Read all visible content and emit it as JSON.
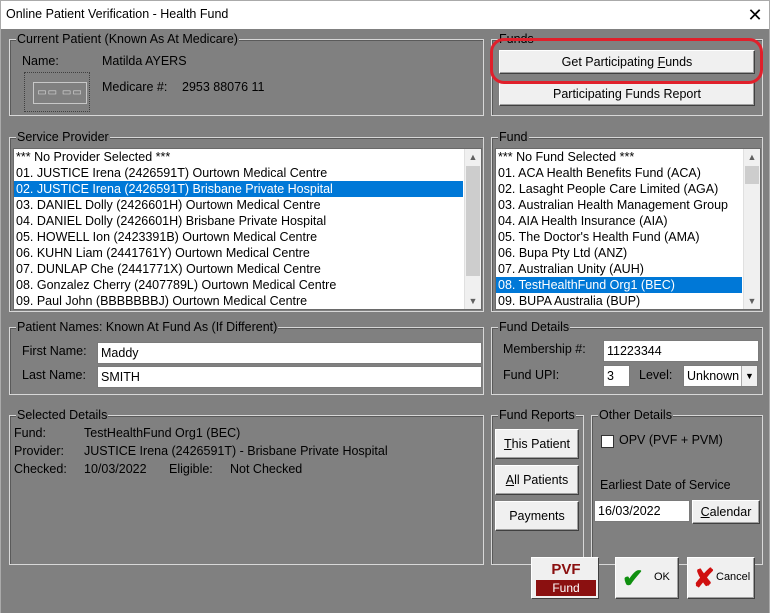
{
  "window": {
    "title": "Online Patient Verification - Health Fund",
    "close_glyph": "✕"
  },
  "current_patient": {
    "legend": "Current Patient  (Known As At Medicare)",
    "name_label": "Name:",
    "name_value": "Matilda AYERS",
    "medicare_label": "Medicare #:",
    "medicare_value": "2953 88076 11",
    "card_glyph": "▭▭ ▭▭"
  },
  "funds_group": {
    "legend": "Funds",
    "get_participating_funds": {
      "pre": "Get Participating ",
      "u": "F",
      "post": "unds"
    },
    "participating_funds_report": "Participating Funds Report",
    "highlight_color": "#e0202b"
  },
  "service_provider": {
    "legend": "Service Provider",
    "items": [
      "*** No Provider Selected ***",
      "01. JUSTICE Irena (2426591T) Ourtown Medical Centre",
      "02. JUSTICE Irena (2426591T) Brisbane Private Hospital",
      "03. DANIEL Dolly (2426601H) Ourtown Medical Centre",
      "04. DANIEL Dolly (2426601H) Brisbane Private Hospital",
      "05. HOWELL Ion (2423391B) Ourtown Medical Centre",
      "06. KUHN Liam (2441761Y) Ourtown Medical Centre",
      "07. DUNLAP Che (2441771X) Ourtown Medical Centre",
      "08. Gonzalez Cherry (2407789L) Ourtown Medical Centre",
      "09. Paul John (BBBBBBBJ) Ourtown Medical Centre"
    ],
    "selected_index": 2
  },
  "fund_list": {
    "legend": "Fund",
    "items": [
      "*** No Fund Selected ***",
      "01. ACA Health Benefits Fund (ACA)",
      "02. Lasaght People Care Limited (AGA)",
      "03. Australian Health Management Group",
      "04. AIA Health Insurance (AIA)",
      "05. The Doctor's Health Fund (AMA)",
      "06. Bupa Pty Ltd (ANZ)",
      "07. Australian Unity (AUH)",
      "08. TestHealthFund Org1 (BEC)",
      "09. BUPA Australia (BUP)"
    ],
    "selected_index": 8
  },
  "patient_names": {
    "legend": "Patient Names: Known At Fund As  (If Different)",
    "first_name_label": "First Name:",
    "first_name_value": "Maddy",
    "last_name_label": "Last Name:",
    "last_name_value": "SMITH"
  },
  "fund_details": {
    "legend": "Fund Details",
    "membership_label": "Membership #:",
    "membership_value": "11223344",
    "upi_label": "Fund UPI:",
    "upi_value": "3",
    "level_label": "Level:",
    "level_value": "Unknown"
  },
  "selected_details": {
    "legend": "Selected Details",
    "fund_label": "Fund:",
    "fund_value": "TestHealthFund Org1  (BEC)",
    "provider_label": "Provider:",
    "provider_value": "JUSTICE Irena (2426591T) - Brisbane Private Hospital",
    "checked_label": "Checked:",
    "checked_value": "10/03/2022",
    "eligible_label": "Eligible:",
    "eligible_value": "Not Checked"
  },
  "fund_reports": {
    "legend": "Fund Reports",
    "this_patient": {
      "u": "T",
      "rest": "his Patient"
    },
    "all_patients": {
      "u": "A",
      "rest": "ll Patients"
    },
    "payments": "Payments"
  },
  "other_details": {
    "legend": "Other Details",
    "opv_label": "OPV (PVF + PVM)",
    "earliest_label": "Earliest Date of Service",
    "earliest_value": "16/03/2022",
    "calendar": {
      "u": "C",
      "rest": "alendar"
    }
  },
  "footer": {
    "pvf_top": "PVF",
    "pvf_bottom": "Fund",
    "ok_label": "OK",
    "cancel_label": "Cancel",
    "check_glyph": "✔",
    "cross_glyph": "✘"
  }
}
